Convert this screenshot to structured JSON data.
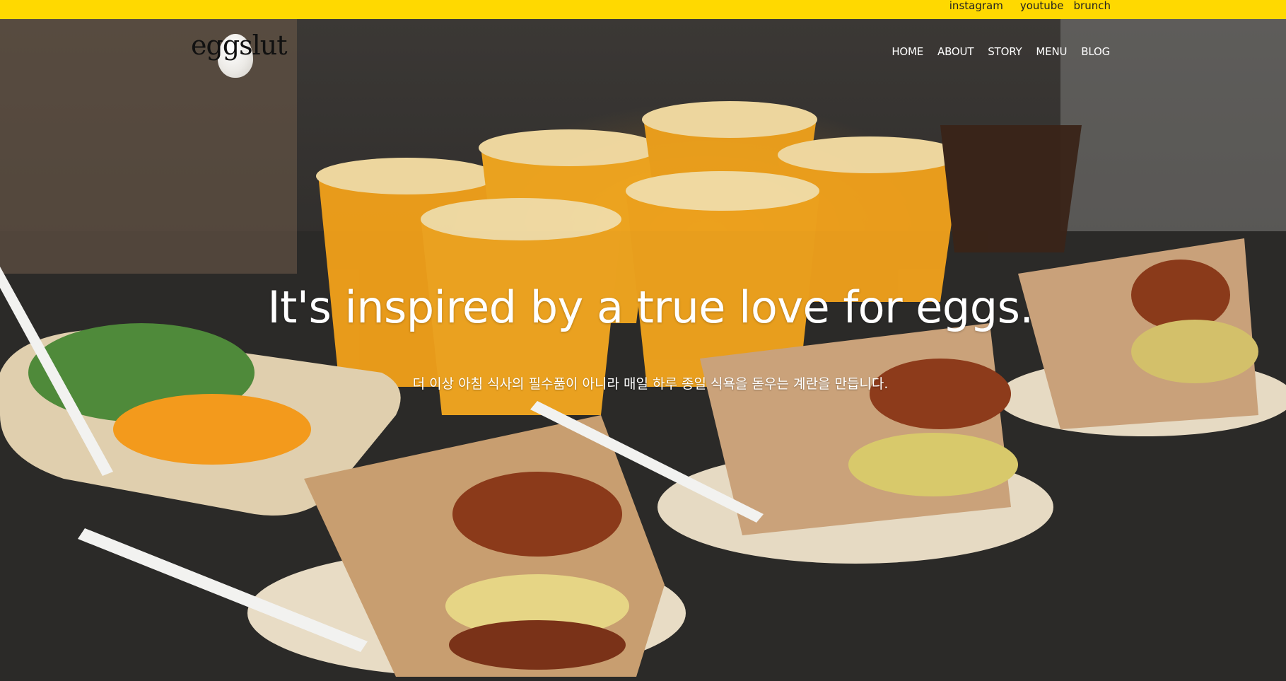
{
  "social": {
    "instagram": "instagram",
    "youtube": "youtube",
    "brunch": "brunch"
  },
  "brand": {
    "logo_text": "eggslut"
  },
  "nav": {
    "home": "HOME",
    "about": "ABOUT",
    "story": "STORY",
    "menu": "MENU",
    "blog": "BLOG"
  },
  "hero": {
    "headline": "It's inspired by a true love for eggs.",
    "subline": "더 이상 아침 식사의 필수품이 아니라 매일 하루 종일 식욕을 돋우는 계란을 만듭니다."
  },
  "colors": {
    "topbar": "#ffd900",
    "nav_text": "#ffffff",
    "headline": "#ffffff"
  }
}
